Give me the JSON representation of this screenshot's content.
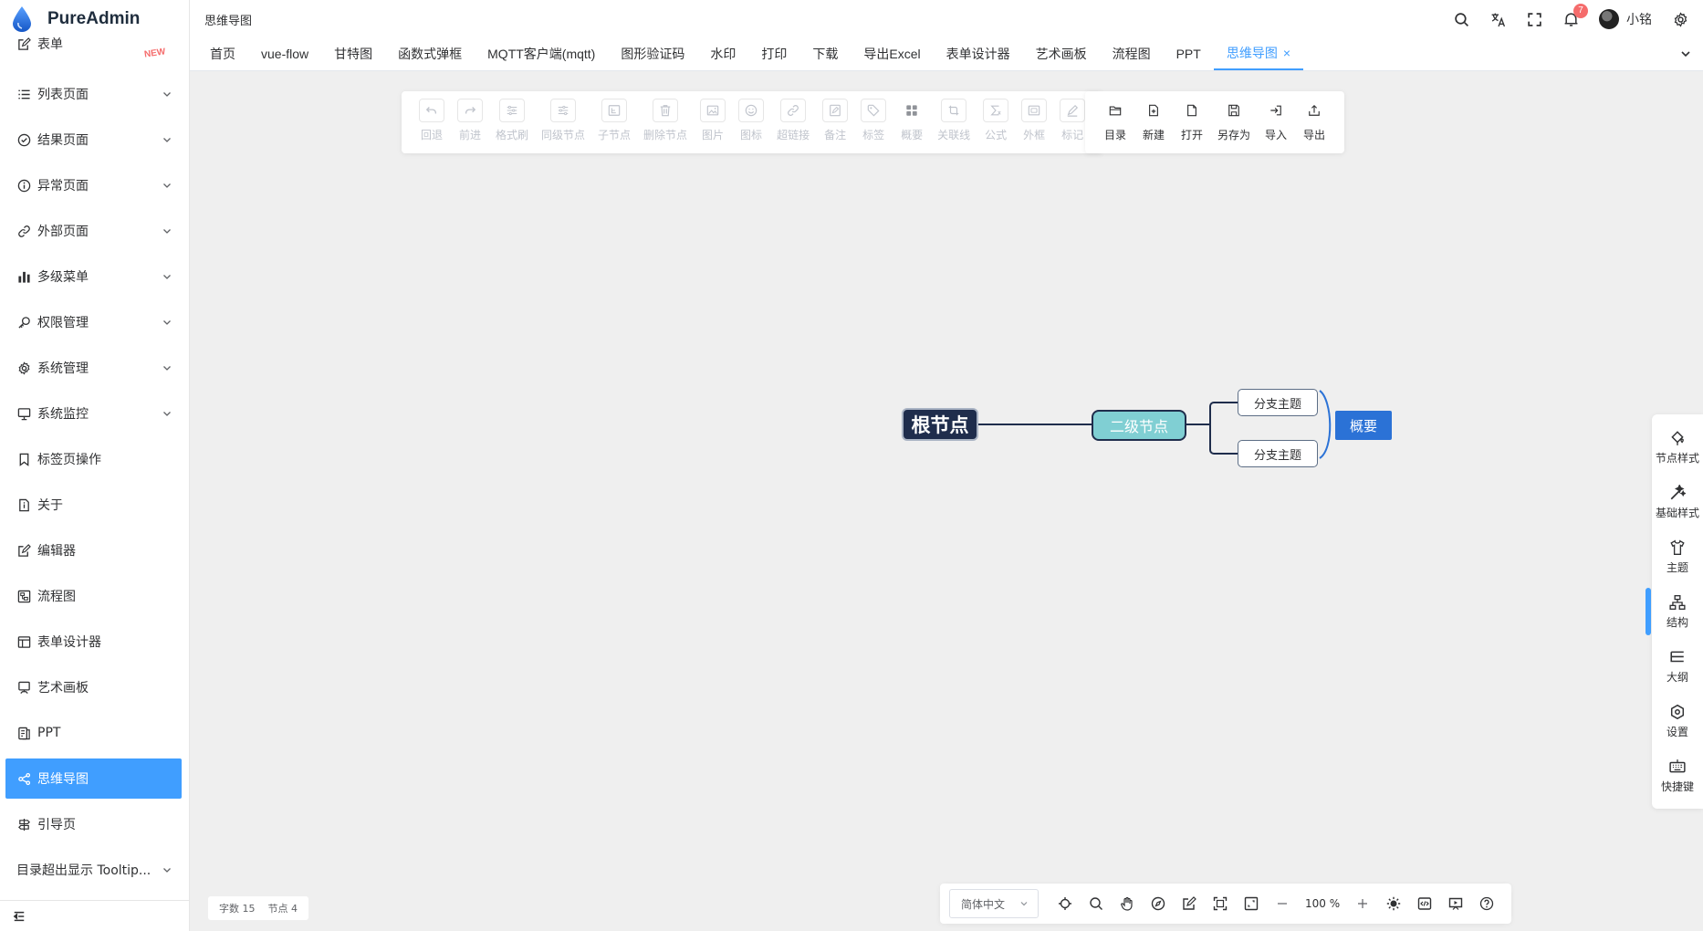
{
  "app": {
    "name": "PureAdmin"
  },
  "sidebar": {
    "items": [
      {
        "label": "表单",
        "icon": "form-icon",
        "badge": "NEW"
      },
      {
        "label": "列表页面",
        "icon": "list-icon",
        "expandable": true
      },
      {
        "label": "结果页面",
        "icon": "check-circle-icon",
        "expandable": true
      },
      {
        "label": "异常页面",
        "icon": "info-circle-icon",
        "expandable": true
      },
      {
        "label": "外部页面",
        "icon": "link-icon",
        "expandable": true
      },
      {
        "label": "多级菜单",
        "icon": "bar-chart-icon",
        "expandable": true
      },
      {
        "label": "权限管理",
        "icon": "key-icon",
        "expandable": true
      },
      {
        "label": "系统管理",
        "icon": "gear-icon",
        "expandable": true
      },
      {
        "label": "系统监控",
        "icon": "monitor-icon",
        "expandable": true
      },
      {
        "label": "标签页操作",
        "icon": "bookmark-icon"
      },
      {
        "label": "关于",
        "icon": "doc-info-icon"
      },
      {
        "label": "编辑器",
        "icon": "edit-icon"
      },
      {
        "label": "流程图",
        "icon": "flow-icon"
      },
      {
        "label": "表单设计器",
        "icon": "layout-icon"
      },
      {
        "label": "艺术画板",
        "icon": "easel-icon"
      },
      {
        "label": "PPT",
        "icon": "ppt-icon"
      },
      {
        "label": "思维导图",
        "icon": "mindmap-icon",
        "active": true
      },
      {
        "label": "引导页",
        "icon": "guide-icon"
      },
      {
        "label": "目录超出显示 Tooltip...",
        "icon": "",
        "expandable": true
      }
    ]
  },
  "header": {
    "breadcrumb": "思维导图",
    "notification_count": "7",
    "username": "小铭"
  },
  "tabs": [
    {
      "label": "首页"
    },
    {
      "label": "vue-flow"
    },
    {
      "label": "甘特图"
    },
    {
      "label": "函数式弹框"
    },
    {
      "label": "MQTT客户端(mqtt)"
    },
    {
      "label": "图形验证码"
    },
    {
      "label": "水印"
    },
    {
      "label": "打印"
    },
    {
      "label": "下载"
    },
    {
      "label": "导出Excel"
    },
    {
      "label": "表单设计器"
    },
    {
      "label": "艺术画板"
    },
    {
      "label": "流程图"
    },
    {
      "label": "PPT"
    },
    {
      "label": "思维导图",
      "active": true,
      "close": "×"
    }
  ],
  "toolbar_main": [
    {
      "label": "回退",
      "icon": "undo-icon"
    },
    {
      "label": "前进",
      "icon": "redo-icon"
    },
    {
      "label": "格式刷",
      "icon": "format-brush-icon"
    },
    {
      "label": "同级节点",
      "icon": "sibling-node-icon"
    },
    {
      "label": "子节点",
      "icon": "child-node-icon"
    },
    {
      "label": "删除节点",
      "icon": "delete-icon"
    },
    {
      "label": "图片",
      "icon": "image-icon"
    },
    {
      "label": "图标",
      "icon": "smile-icon"
    },
    {
      "label": "超链接",
      "icon": "link-icon"
    },
    {
      "label": "备注",
      "icon": "note-icon"
    },
    {
      "label": "标签",
      "icon": "tag-icon"
    },
    {
      "label": "概要",
      "icon": "summary-icon"
    },
    {
      "label": "关联线",
      "icon": "relation-line-icon"
    },
    {
      "label": "公式",
      "icon": "formula-icon"
    },
    {
      "label": "外框",
      "icon": "frame-icon"
    },
    {
      "label": "标记",
      "icon": "mark-icon"
    }
  ],
  "toolbar_file": [
    {
      "label": "目录",
      "icon": "folder-icon"
    },
    {
      "label": "新建",
      "icon": "new-file-icon"
    },
    {
      "label": "打开",
      "icon": "open-file-icon"
    },
    {
      "label": "另存为",
      "icon": "save-as-icon"
    },
    {
      "label": "导入",
      "icon": "import-icon"
    },
    {
      "label": "导出",
      "icon": "export-icon"
    }
  ],
  "mindmap": {
    "root": "根节点",
    "second": "二级节点",
    "branch1": "分支主题",
    "branch2": "分支主题",
    "summary": "概要"
  },
  "side_panel": [
    {
      "label": "节点样式",
      "icon": "paint-icon"
    },
    {
      "label": "基础样式",
      "icon": "magic-wand-icon"
    },
    {
      "label": "主题",
      "icon": "shirt-icon"
    },
    {
      "label": "结构",
      "icon": "structure-icon",
      "active": true
    },
    {
      "label": "大纲",
      "icon": "outline-icon"
    },
    {
      "label": "设置",
      "icon": "settings-icon"
    },
    {
      "label": "快捷键",
      "icon": "keyboard-icon"
    }
  ],
  "status": {
    "word_count": "字数 15",
    "node_count": "节点 4"
  },
  "bottom_bar": {
    "language": "简体中文",
    "zoom": "100 %"
  },
  "colors": {
    "accent": "#409eff",
    "root_bg": "#1f2d4c",
    "second_bg": "#80cfd3",
    "summary_bg": "#2b72d6",
    "canvas_bg": "#efefef"
  }
}
